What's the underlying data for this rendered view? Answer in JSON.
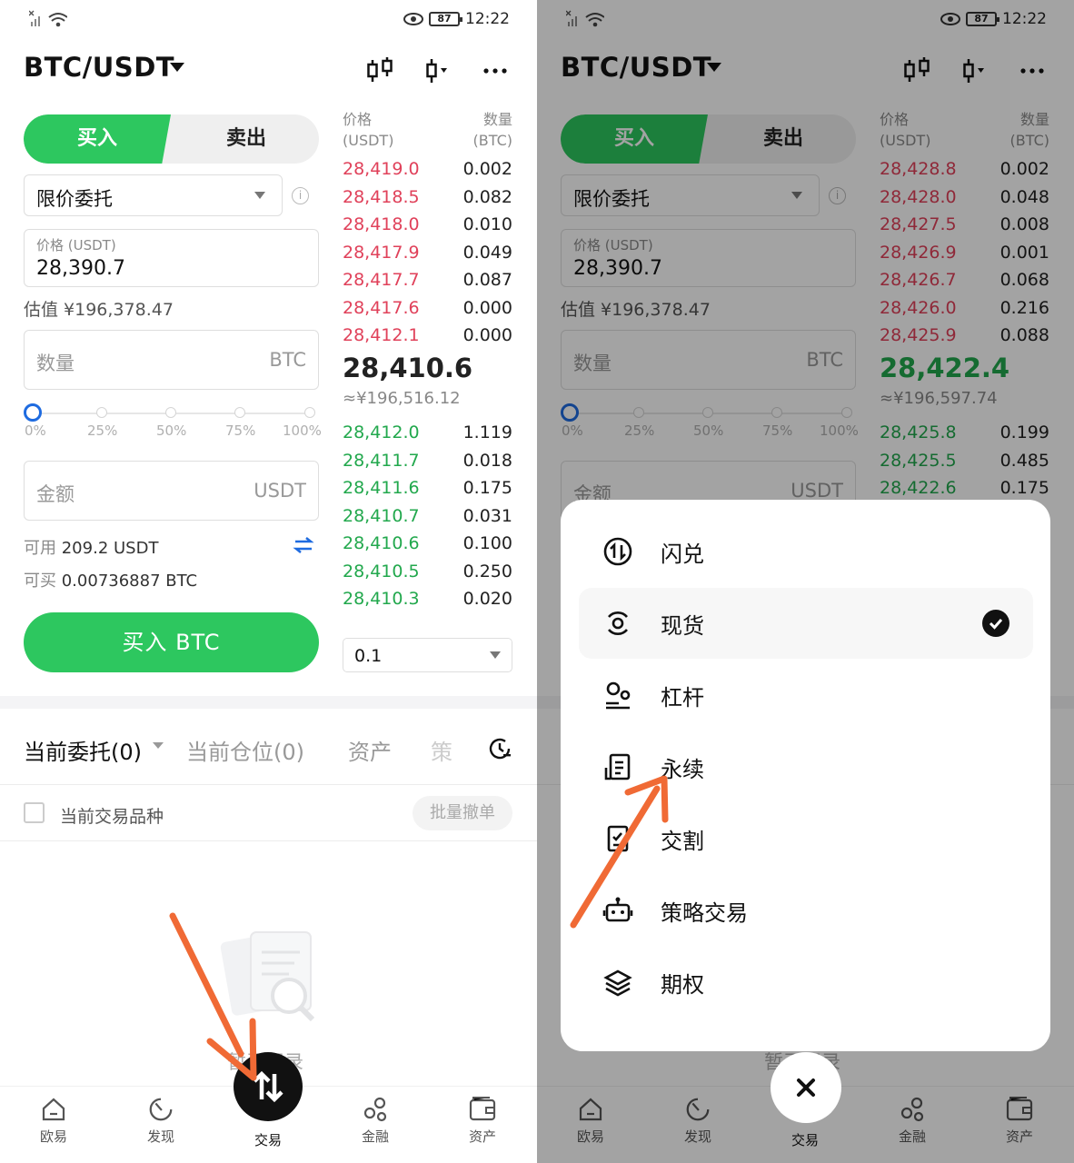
{
  "status": {
    "battery": "87",
    "time": "12:22"
  },
  "header": {
    "pair": "BTC/USDT"
  },
  "trade": {
    "buy_tab": "买入",
    "sell_tab": "卖出",
    "order_type": "限价委托",
    "price_caption": "价格 (USDT)",
    "price_value": "28,390.7",
    "estimate": "估值 ¥196,378.47",
    "qty_placeholder": "数量",
    "qty_unit": "BTC",
    "slider_marks": [
      "0%",
      "25%",
      "50%",
      "75%",
      "100%"
    ],
    "slider_value_percent": 0,
    "amount_placeholder": "金额",
    "amount_unit": "USDT",
    "available_label": "可用",
    "available_value": "209.2 USDT",
    "buyable_label": "可买",
    "buyable_value": "0.00736887 BTC",
    "buy_button": "买入 BTC"
  },
  "orderbook_left": {
    "price_header": [
      "价格",
      "(USDT)"
    ],
    "qty_header": [
      "数量",
      "(BTC)"
    ],
    "asks": [
      [
        "28,419.0",
        "0.002"
      ],
      [
        "28,418.5",
        "0.082"
      ],
      [
        "28,418.0",
        "0.010"
      ],
      [
        "28,417.9",
        "0.049"
      ],
      [
        "28,417.7",
        "0.087"
      ],
      [
        "28,417.6",
        "0.000"
      ],
      [
        "28,412.1",
        "0.000"
      ]
    ],
    "last_price": "28,410.6",
    "last_cny": "≈¥196,516.12",
    "bids": [
      [
        "28,412.0",
        "1.119"
      ],
      [
        "28,411.7",
        "0.018"
      ],
      [
        "28,411.6",
        "0.175"
      ],
      [
        "28,410.7",
        "0.031"
      ],
      [
        "28,410.6",
        "0.100"
      ],
      [
        "28,410.5",
        "0.250"
      ],
      [
        "28,410.3",
        "0.020"
      ]
    ],
    "depth": "0.1"
  },
  "orderbook_right": {
    "asks": [
      [
        "28,428.8",
        "0.002"
      ],
      [
        "28,428.0",
        "0.048"
      ],
      [
        "28,427.5",
        "0.008"
      ],
      [
        "28,426.9",
        "0.001"
      ],
      [
        "28,426.7",
        "0.068"
      ],
      [
        "28,426.0",
        "0.216"
      ],
      [
        "28,425.9",
        "0.088"
      ]
    ],
    "last_price": "28,422.4",
    "last_cny": "≈¥196,597.74",
    "bids": [
      [
        "28,425.8",
        "0.199"
      ],
      [
        "28,425.5",
        "0.485"
      ],
      [
        "28,422.6",
        "0.175"
      ]
    ]
  },
  "orders": {
    "tabs": [
      "当前委托(0)",
      "当前仓位(0)",
      "资产",
      "策"
    ],
    "filter_label": "当前交易品种",
    "cancel_all": "批量撤单",
    "empty": "暂无记录"
  },
  "nav": [
    "欧易",
    "发现",
    "交易",
    "金融",
    "资产"
  ],
  "menu": {
    "items": [
      "闪兑",
      "现货",
      "杠杆",
      "永续",
      "交割",
      "策略交易",
      "期权"
    ],
    "selected": "现货"
  },
  "colors": {
    "buy": "#2dc75f",
    "ask": "#e0415a",
    "bid": "#22a84d",
    "accent": "#1e6be0",
    "arrow": "#f06a35"
  }
}
